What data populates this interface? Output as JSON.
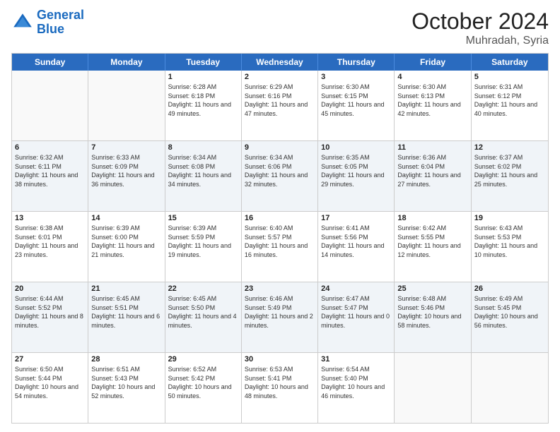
{
  "logo": {
    "line1": "General",
    "line2": "Blue"
  },
  "title": "October 2024",
  "location": "Muhradah, Syria",
  "weekdays": [
    "Sunday",
    "Monday",
    "Tuesday",
    "Wednesday",
    "Thursday",
    "Friday",
    "Saturday"
  ],
  "weeks": [
    [
      {
        "day": "",
        "info": ""
      },
      {
        "day": "",
        "info": ""
      },
      {
        "day": "1",
        "info": "Sunrise: 6:28 AM\nSunset: 6:18 PM\nDaylight: 11 hours and 49 minutes."
      },
      {
        "day": "2",
        "info": "Sunrise: 6:29 AM\nSunset: 6:16 PM\nDaylight: 11 hours and 47 minutes."
      },
      {
        "day": "3",
        "info": "Sunrise: 6:30 AM\nSunset: 6:15 PM\nDaylight: 11 hours and 45 minutes."
      },
      {
        "day": "4",
        "info": "Sunrise: 6:30 AM\nSunset: 6:13 PM\nDaylight: 11 hours and 42 minutes."
      },
      {
        "day": "5",
        "info": "Sunrise: 6:31 AM\nSunset: 6:12 PM\nDaylight: 11 hours and 40 minutes."
      }
    ],
    [
      {
        "day": "6",
        "info": "Sunrise: 6:32 AM\nSunset: 6:11 PM\nDaylight: 11 hours and 38 minutes."
      },
      {
        "day": "7",
        "info": "Sunrise: 6:33 AM\nSunset: 6:09 PM\nDaylight: 11 hours and 36 minutes."
      },
      {
        "day": "8",
        "info": "Sunrise: 6:34 AM\nSunset: 6:08 PM\nDaylight: 11 hours and 34 minutes."
      },
      {
        "day": "9",
        "info": "Sunrise: 6:34 AM\nSunset: 6:06 PM\nDaylight: 11 hours and 32 minutes."
      },
      {
        "day": "10",
        "info": "Sunrise: 6:35 AM\nSunset: 6:05 PM\nDaylight: 11 hours and 29 minutes."
      },
      {
        "day": "11",
        "info": "Sunrise: 6:36 AM\nSunset: 6:04 PM\nDaylight: 11 hours and 27 minutes."
      },
      {
        "day": "12",
        "info": "Sunrise: 6:37 AM\nSunset: 6:02 PM\nDaylight: 11 hours and 25 minutes."
      }
    ],
    [
      {
        "day": "13",
        "info": "Sunrise: 6:38 AM\nSunset: 6:01 PM\nDaylight: 11 hours and 23 minutes."
      },
      {
        "day": "14",
        "info": "Sunrise: 6:39 AM\nSunset: 6:00 PM\nDaylight: 11 hours and 21 minutes."
      },
      {
        "day": "15",
        "info": "Sunrise: 6:39 AM\nSunset: 5:59 PM\nDaylight: 11 hours and 19 minutes."
      },
      {
        "day": "16",
        "info": "Sunrise: 6:40 AM\nSunset: 5:57 PM\nDaylight: 11 hours and 16 minutes."
      },
      {
        "day": "17",
        "info": "Sunrise: 6:41 AM\nSunset: 5:56 PM\nDaylight: 11 hours and 14 minutes."
      },
      {
        "day": "18",
        "info": "Sunrise: 6:42 AM\nSunset: 5:55 PM\nDaylight: 11 hours and 12 minutes."
      },
      {
        "day": "19",
        "info": "Sunrise: 6:43 AM\nSunset: 5:53 PM\nDaylight: 11 hours and 10 minutes."
      }
    ],
    [
      {
        "day": "20",
        "info": "Sunrise: 6:44 AM\nSunset: 5:52 PM\nDaylight: 11 hours and 8 minutes."
      },
      {
        "day": "21",
        "info": "Sunrise: 6:45 AM\nSunset: 5:51 PM\nDaylight: 11 hours and 6 minutes."
      },
      {
        "day": "22",
        "info": "Sunrise: 6:45 AM\nSunset: 5:50 PM\nDaylight: 11 hours and 4 minutes."
      },
      {
        "day": "23",
        "info": "Sunrise: 6:46 AM\nSunset: 5:49 PM\nDaylight: 11 hours and 2 minutes."
      },
      {
        "day": "24",
        "info": "Sunrise: 6:47 AM\nSunset: 5:47 PM\nDaylight: 11 hours and 0 minutes."
      },
      {
        "day": "25",
        "info": "Sunrise: 6:48 AM\nSunset: 5:46 PM\nDaylight: 10 hours and 58 minutes."
      },
      {
        "day": "26",
        "info": "Sunrise: 6:49 AM\nSunset: 5:45 PM\nDaylight: 10 hours and 56 minutes."
      }
    ],
    [
      {
        "day": "27",
        "info": "Sunrise: 6:50 AM\nSunset: 5:44 PM\nDaylight: 10 hours and 54 minutes."
      },
      {
        "day": "28",
        "info": "Sunrise: 6:51 AM\nSunset: 5:43 PM\nDaylight: 10 hours and 52 minutes."
      },
      {
        "day": "29",
        "info": "Sunrise: 6:52 AM\nSunset: 5:42 PM\nDaylight: 10 hours and 50 minutes."
      },
      {
        "day": "30",
        "info": "Sunrise: 6:53 AM\nSunset: 5:41 PM\nDaylight: 10 hours and 48 minutes."
      },
      {
        "day": "31",
        "info": "Sunrise: 6:54 AM\nSunset: 5:40 PM\nDaylight: 10 hours and 46 minutes."
      },
      {
        "day": "",
        "info": ""
      },
      {
        "day": "",
        "info": ""
      }
    ]
  ]
}
